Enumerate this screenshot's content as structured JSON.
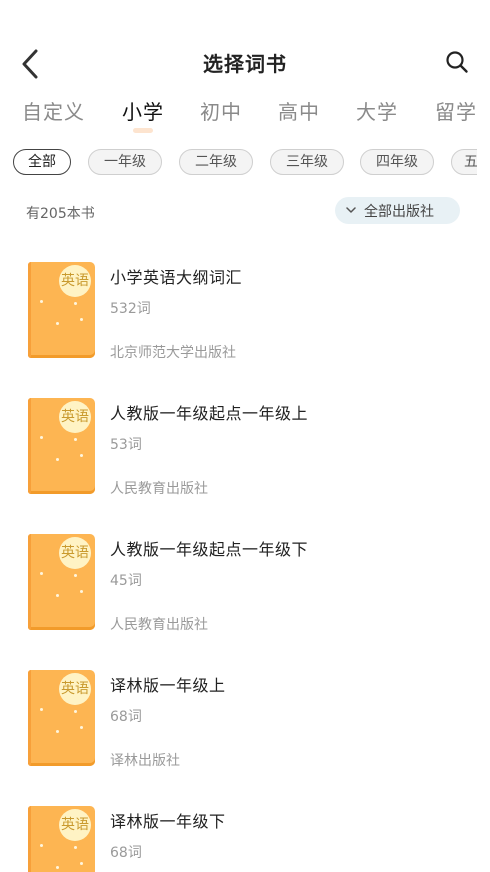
{
  "header": {
    "title": "选择词书"
  },
  "tabs": [
    {
      "label": "自定义",
      "active": false
    },
    {
      "label": "小学",
      "active": true
    },
    {
      "label": "初中",
      "active": false
    },
    {
      "label": "高中",
      "active": false
    },
    {
      "label": "大学",
      "active": false
    },
    {
      "label": "留学",
      "active": false
    }
  ],
  "grade_chips": [
    {
      "label": "全部",
      "active": true
    },
    {
      "label": "一年级",
      "active": false
    },
    {
      "label": "二年级",
      "active": false
    },
    {
      "label": "三年级",
      "active": false
    },
    {
      "label": "四年级",
      "active": false
    },
    {
      "label": "五",
      "active": false
    }
  ],
  "summary": {
    "count_text": "有205本书",
    "publisher_filter": "全部出版社"
  },
  "cover_label": "英语",
  "books": [
    {
      "title": "小学英语大纲词汇",
      "words": "532词",
      "publisher": "北京师范大学出版社"
    },
    {
      "title": "人教版一年级起点一年级上",
      "words": "53词",
      "publisher": "人民教育出版社"
    },
    {
      "title": "人教版一年级起点一年级下",
      "words": "45词",
      "publisher": "人民教育出版社"
    },
    {
      "title": "译林版一年级上",
      "words": "68词",
      "publisher": "译林出版社"
    },
    {
      "title": "译林版一年级下",
      "words": "68词",
      "publisher": ""
    }
  ],
  "colors": {
    "cover": "#fdb552",
    "badge": "#fff3c4",
    "filter_bg": "#e8f1f5",
    "tab_indicator": "#fde4cf"
  }
}
